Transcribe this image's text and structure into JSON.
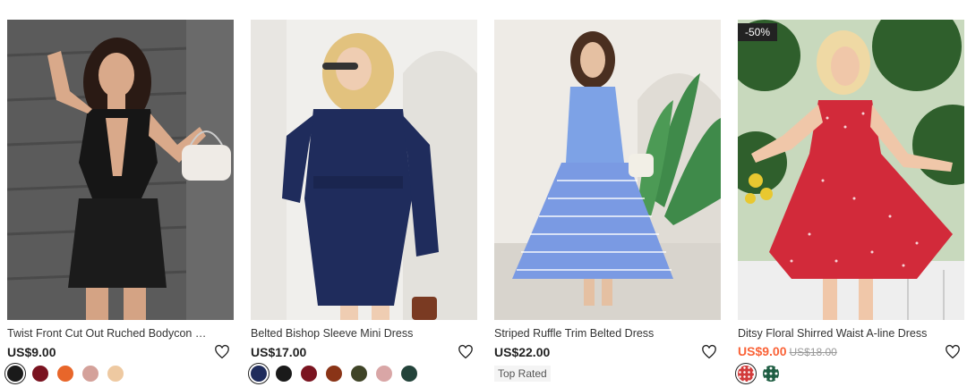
{
  "products": [
    {
      "name": "Twist Front Cut Out Ruched Bodycon Dress",
      "price": "US$9.00",
      "swatches": [
        "#1a1a1a",
        "#7a1320",
        "#e8662a",
        "#d4a19a",
        "#eec9a1"
      ]
    },
    {
      "name": "Belted Bishop Sleeve Mini Dress",
      "price": "US$17.00",
      "swatches": [
        "#1f2c5c",
        "#1a1a1a",
        "#7a1420",
        "#8a3417",
        "#3f4427",
        "#d9a6a6",
        "#23433a"
      ]
    },
    {
      "name": "Striped Ruffle Trim Belted Dress",
      "price": "US$22.00",
      "tag": "Top Rated"
    },
    {
      "badge": "-50%",
      "name": "Ditsy Floral Shirred Waist A-line Dress",
      "price": "US$9.00",
      "original_price": "US$18.00",
      "swatches": [
        "#d23b3b",
        "#1f5e43"
      ]
    }
  ]
}
